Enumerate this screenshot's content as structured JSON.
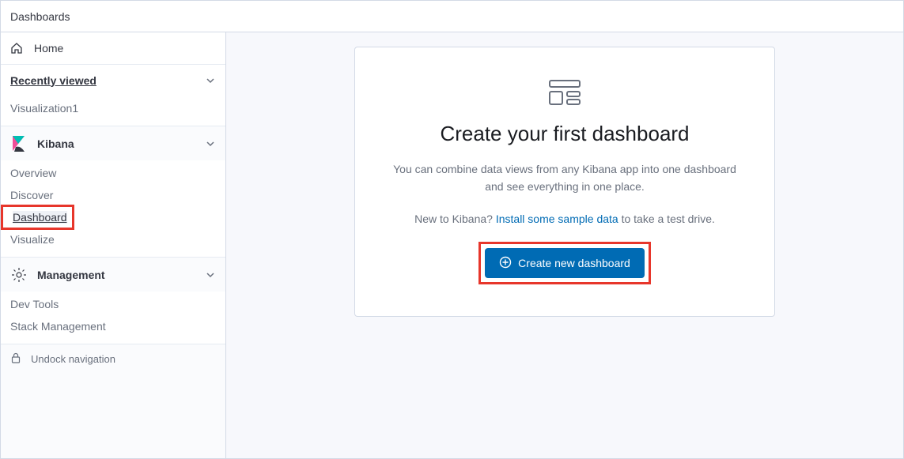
{
  "topbar": {
    "title": "Dashboards"
  },
  "sidebar": {
    "home": "Home",
    "recently_viewed": {
      "label": "Recently viewed",
      "items": [
        "Visualization1"
      ]
    },
    "kibana": {
      "label": "Kibana",
      "items": [
        "Overview",
        "Discover",
        "Dashboard",
        "Visualize"
      ],
      "active_index": 2
    },
    "management": {
      "label": "Management",
      "items": [
        "Dev Tools",
        "Stack Management"
      ]
    },
    "undock": "Undock navigation"
  },
  "main": {
    "title": "Create your first dashboard",
    "desc": "You can combine data views from any Kibana app into one dashboard and see everything in one place.",
    "hint_pre": "New to Kibana? ",
    "hint_link": "Install some sample data",
    "hint_post": " to take a test drive.",
    "cta": "Create new dashboard"
  }
}
